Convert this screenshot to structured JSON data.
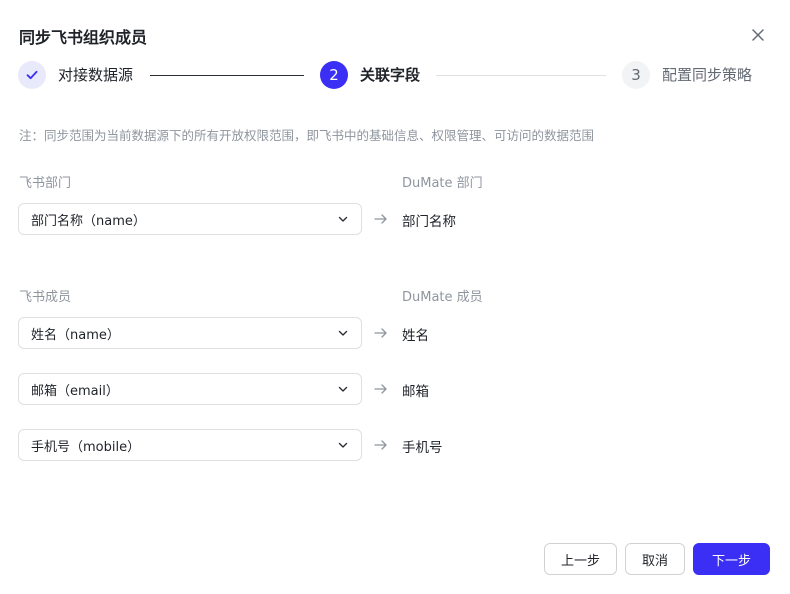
{
  "dialog": {
    "title": "同步飞书组织成员"
  },
  "steps": [
    {
      "number": "1",
      "label": "对接数据源",
      "state": "done"
    },
    {
      "number": "2",
      "label": "关联字段",
      "state": "active"
    },
    {
      "number": "3",
      "label": "配置同步策略",
      "state": "wait"
    }
  ],
  "note": "注：同步范围为当前数据源下的所有开放权限范围，即飞书中的基础信息、权限管理、可访问的数据范围",
  "department": {
    "source_label": "飞书部门",
    "target_label": "DuMate 部门",
    "mappings": [
      {
        "source": "部门名称（name）",
        "target": "部门名称"
      }
    ]
  },
  "member": {
    "source_label": "飞书成员",
    "target_label": "DuMate 成员",
    "mappings": [
      {
        "source": "姓名（name）",
        "target": "姓名"
      },
      {
        "source": "邮箱（email）",
        "target": "邮箱"
      },
      {
        "source": "手机号（mobile）",
        "target": "手机号"
      }
    ]
  },
  "footer": {
    "prev_label": "上一步",
    "cancel_label": "取消",
    "next_label": "下一步"
  },
  "colors": {
    "primary": "#3b2ef5",
    "done_circle_bg": "#e8e9fb",
    "muted_text": "#8f959e"
  }
}
